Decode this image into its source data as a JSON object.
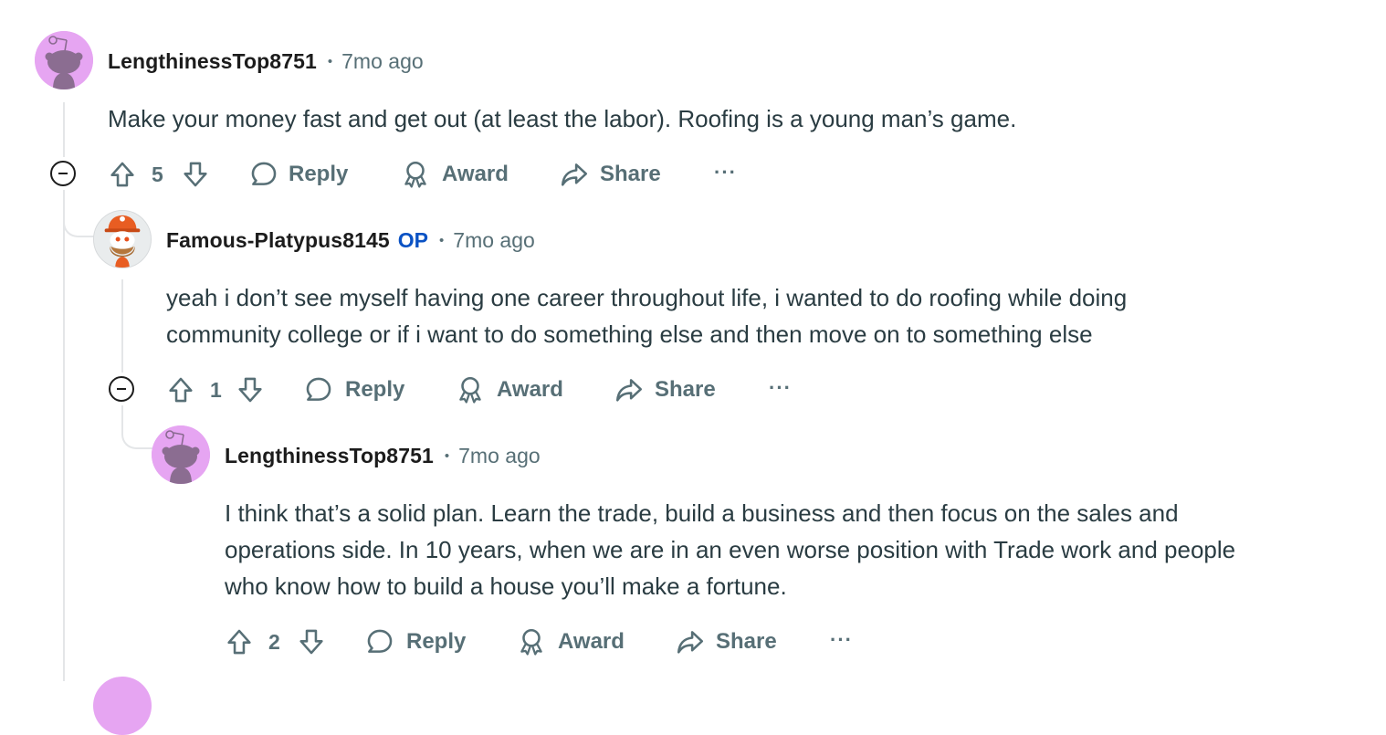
{
  "comments": [
    {
      "username": "LengthinessTop8751",
      "op_badge": "",
      "separator": "•",
      "time": "7mo ago",
      "avatar": "snoo-avatar-icon",
      "body_lines": [
        "Make your money fast and get out (at least the labor). Roofing is a young man’s game."
      ],
      "votes": "5",
      "reply_label": "Reply",
      "award_label": "Award",
      "share_label": "Share",
      "more_label": "···"
    },
    {
      "username": "Famous-Platypus8145",
      "op_badge": "OP",
      "separator": "•",
      "time": "7mo ago",
      "avatar": "snoo-hardhat-avatar-icon",
      "body_lines": [
        "yeah i don’t see myself having one career throughout life, i wanted to do roofing while doing",
        "community college or if i want to do something else and then move on to something else"
      ],
      "votes": "1",
      "reply_label": "Reply",
      "award_label": "Award",
      "share_label": "Share",
      "more_label": "···"
    },
    {
      "username": "LengthinessTop8751",
      "op_badge": "",
      "separator": "•",
      "time": "7mo ago",
      "avatar": "snoo-avatar-icon",
      "body_lines": [
        "I think that’s a solid plan. Learn the trade, build a business and then focus on the sales and",
        "operations side. In 10 years, when we are in an even worse position with Trade work and people",
        "who know how to build a house you’ll make a fortune."
      ],
      "votes": "2",
      "reply_label": "Reply",
      "award_label": "Award",
      "share_label": "Share",
      "more_label": "···"
    }
  ],
  "colors": {
    "accent_op": "#0a52c4",
    "meta_gray": "#576f76",
    "thread_line": "#e4e6e8",
    "avatar_purple": "#e6a5f2"
  }
}
